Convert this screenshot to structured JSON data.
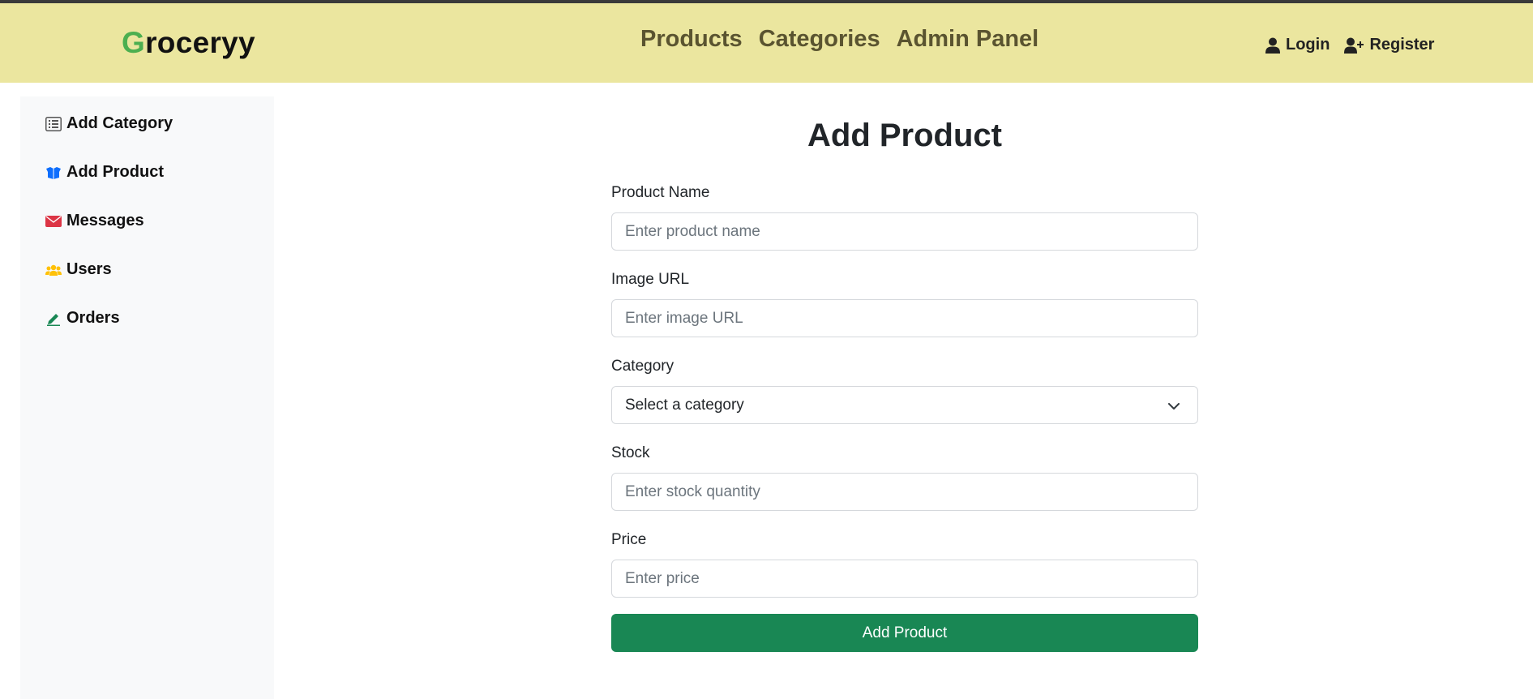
{
  "navbar": {
    "brand_first": "G",
    "brand_rest": "roceryy",
    "links": [
      {
        "label": "Products"
      },
      {
        "label": "Categories"
      },
      {
        "label": "Admin Panel"
      }
    ],
    "auth": [
      {
        "label": "Login",
        "icon": "user-icon"
      },
      {
        "label": "Register",
        "icon": "user-plus-icon"
      }
    ],
    "background_color": "#ebe69f",
    "brand_accent_color": "#4caf50"
  },
  "sidebar": {
    "items": [
      {
        "label": "Add Category",
        "icon": "list-icon",
        "icon_color": "#555555"
      },
      {
        "label": "Add Product",
        "icon": "box-open-icon",
        "icon_color": "#0d6efd"
      },
      {
        "label": "Messages",
        "icon": "envelope-icon",
        "icon_color": "#dc3545"
      },
      {
        "label": "Users",
        "icon": "users-icon",
        "icon_color": "#ffc107"
      },
      {
        "label": "Orders",
        "icon": "pen-icon",
        "icon_color": "#198754"
      }
    ]
  },
  "form": {
    "title": "Add Product",
    "product_name": {
      "label": "Product Name",
      "placeholder": "Enter product name",
      "value": ""
    },
    "image_url": {
      "label": "Image URL",
      "placeholder": "Enter image URL",
      "value": ""
    },
    "category": {
      "label": "Category",
      "selected": "Select a category"
    },
    "stock": {
      "label": "Stock",
      "placeholder": "Enter stock quantity",
      "value": ""
    },
    "price": {
      "label": "Price",
      "placeholder": "Enter price",
      "value": ""
    },
    "submit_label": "Add Product",
    "submit_color": "#198754"
  }
}
